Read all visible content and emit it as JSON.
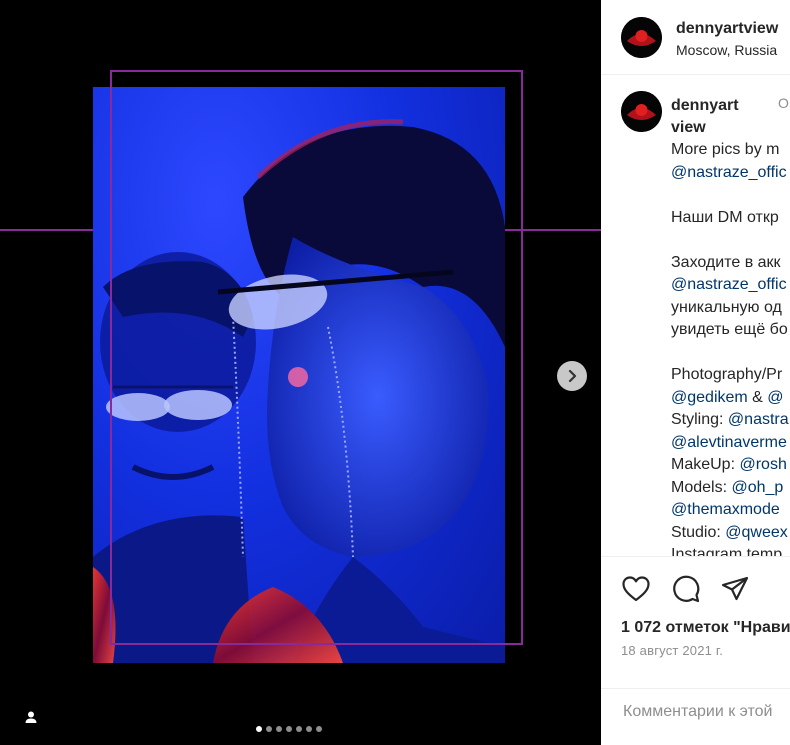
{
  "post": {
    "username": "dennyartview",
    "location": "Moscow, Russia",
    "caption_username": "dennyartview",
    "caption_time": "O",
    "caption_lines": [
      {
        "parts": [
          {
            "t": "More pics by m",
            "m": false
          }
        ]
      },
      {
        "parts": [
          {
            "t": "@nastraze_offic",
            "m": true
          }
        ]
      },
      {
        "gap": true
      },
      {
        "parts": [
          {
            "t": "Наши DM откр",
            "m": false
          }
        ]
      },
      {
        "gap": true
      },
      {
        "parts": [
          {
            "t": "Заходите в акк",
            "m": false
          }
        ]
      },
      {
        "parts": [
          {
            "t": "@nastraze_offic",
            "m": true
          }
        ]
      },
      {
        "parts": [
          {
            "t": "уникальную од",
            "m": false
          }
        ]
      },
      {
        "parts": [
          {
            "t": "увидеть ещё бо",
            "m": false
          }
        ]
      },
      {
        "gap": true
      },
      {
        "parts": [
          {
            "t": "Photography/Pr",
            "m": false
          }
        ]
      },
      {
        "parts": [
          {
            "t": "@gedikem",
            "m": true
          },
          {
            "t": " & ",
            "m": false
          },
          {
            "t": "@",
            "m": true
          }
        ]
      },
      {
        "parts": [
          {
            "t": "Styling: ",
            "m": false
          },
          {
            "t": "@nastra",
            "m": true
          }
        ]
      },
      {
        "parts": [
          {
            "t": "@alevtinaverme",
            "m": true
          }
        ]
      },
      {
        "parts": [
          {
            "t": "MakeUp: ",
            "m": false
          },
          {
            "t": "@rosh",
            "m": true
          }
        ]
      },
      {
        "parts": [
          {
            "t": "Models: ",
            "m": false
          },
          {
            "t": "@oh_p",
            "m": true
          }
        ]
      },
      {
        "parts": [
          {
            "t": "@themaxmode",
            "m": true
          }
        ]
      },
      {
        "parts": [
          {
            "t": "Studio: ",
            "m": false
          },
          {
            "t": "@qweex",
            "m": true
          }
        ]
      },
      {
        "parts": [
          {
            "t": "Instagram temp",
            "m": false
          }
        ]
      }
    ],
    "likes": "1 072 отметок \"Нрави",
    "date": "18 август 2021 г.",
    "comment_placeholder": "Комментарии к этой"
  },
  "carousel": {
    "slide_count": 7,
    "active_index": 0
  },
  "icons": {
    "next": "chevron-right-icon",
    "tagged": "user-icon",
    "like": "heart-icon",
    "comment": "comment-icon",
    "share": "paper-plane-icon"
  },
  "colors": {
    "frame": "#8a2a9a",
    "mention": "#00376b",
    "muted": "#8e8e8e",
    "text": "#262626"
  }
}
